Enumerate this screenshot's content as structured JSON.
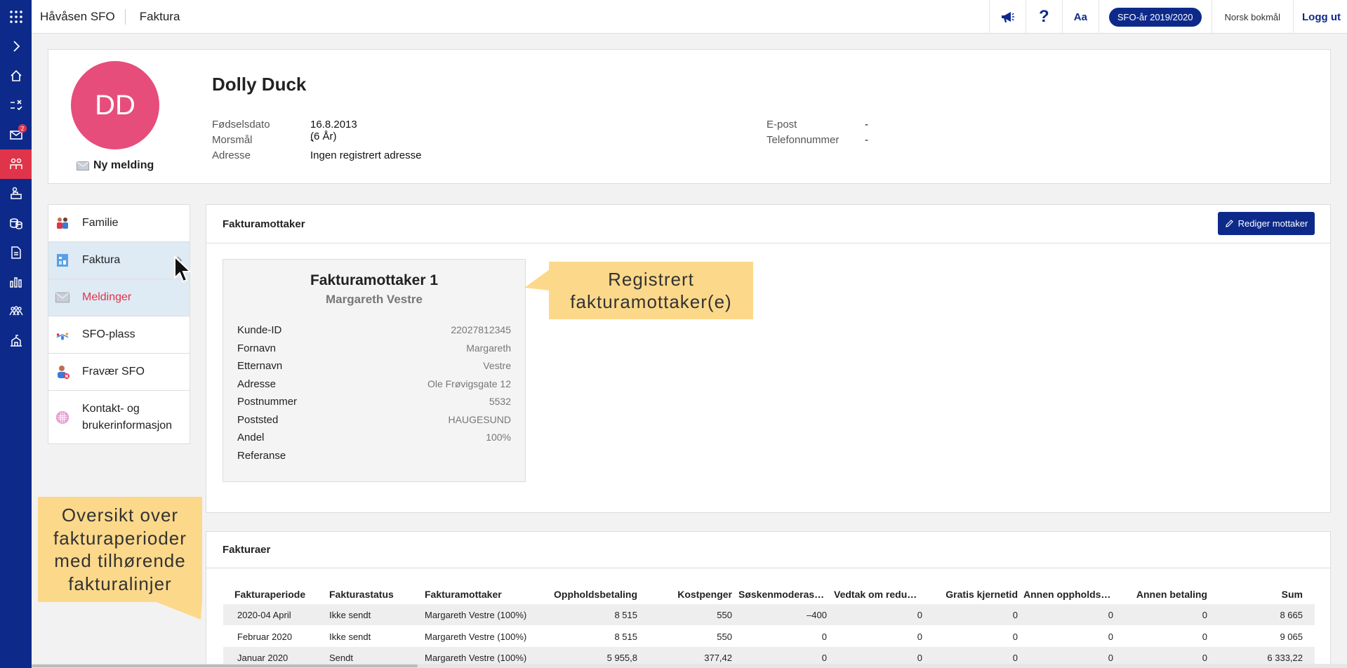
{
  "app": {
    "name": "Håvåsen SFO",
    "section": "Faktura"
  },
  "topbar": {
    "help_label": "?",
    "font_label": "Aa",
    "year_label": "SFO-år 2019/2020",
    "language_label": "Norsk bokmål",
    "logout_label": "Logg ut"
  },
  "rail": {
    "unread_count": "2",
    "items": [
      "apps-icon",
      "expand-icon",
      "home-icon",
      "tasks-icon",
      "mail-icon",
      "children-icon",
      "sfo-icon",
      "payment-icon",
      "document-icon",
      "stats-icon",
      "groups-icon",
      "school-icon"
    ]
  },
  "profile": {
    "initials": "DD",
    "name": "Dolly Duck",
    "new_message": "Ny melding",
    "fields_left": [
      {
        "label": "Fødselsdato",
        "value": "16.8.2013 (6 År)"
      },
      {
        "label": "Morsmål",
        "value": "-"
      },
      {
        "label": "Adresse",
        "value": "Ingen registrert adresse"
      }
    ],
    "fields_right": [
      {
        "label": "E-post",
        "value": "-"
      },
      {
        "label": "Telefonnummer",
        "value": "-"
      }
    ]
  },
  "nav": {
    "items": [
      {
        "label": "Familie"
      },
      {
        "label": "Faktura"
      },
      {
        "label": "Meldinger"
      },
      {
        "label": "SFO-plass"
      },
      {
        "label": "Fravær SFO"
      },
      {
        "label": "Kontakt- og\nbrukerinformasjon"
      }
    ]
  },
  "recipients": {
    "title": "Fakturamottaker",
    "edit_button": "Rediger mottaker",
    "card": {
      "title": "Fakturamottaker 1",
      "subtitle": "Margareth Vestre",
      "rows": [
        {
          "label": "Kunde-ID",
          "value": "22027812345"
        },
        {
          "label": "Fornavn",
          "value": "Margareth"
        },
        {
          "label": "Etternavn",
          "value": "Vestre"
        },
        {
          "label": "Adresse",
          "value": "Ole Frøvigsgate 12"
        },
        {
          "label": "Postnummer",
          "value": "5532"
        },
        {
          "label": "Poststed",
          "value": "HAUGESUND"
        },
        {
          "label": "Andel",
          "value": "100%"
        },
        {
          "label": "Referanse",
          "value": ""
        }
      ]
    }
  },
  "callouts": {
    "registered": "Registrert\nfakturamottaker(e)",
    "overview": "Oversikt over\nfakturaperioder\nmed tilhørende\nfakturalinjer"
  },
  "invoices": {
    "title": "Fakturaer",
    "columns": [
      "Fakturaperiode",
      "Fakturastatus",
      "Fakturamottaker",
      "Oppholdsbetaling",
      "Kostpenger",
      "Søskenmoderas…",
      "Vedtak om redu…",
      "Gratis kjernetid",
      "Annen oppholds…",
      "Annen betaling",
      "Sum"
    ],
    "rows": [
      [
        "2020-04 April",
        "Ikke sendt",
        "Margareth Vestre (100%)",
        "8 515",
        "550",
        "–400",
        "0",
        "0",
        "0",
        "0",
        "8 665"
      ],
      [
        "Februar 2020",
        "Ikke sendt",
        "Margareth Vestre (100%)",
        "8 515",
        "550",
        "0",
        "0",
        "0",
        "0",
        "0",
        "9 065"
      ],
      [
        "Januar 2020",
        "Sendt",
        "Margareth Vestre (100%)",
        "5 955,8",
        "377,42",
        "0",
        "0",
        "0",
        "0",
        "0",
        "6 333,22"
      ]
    ]
  }
}
